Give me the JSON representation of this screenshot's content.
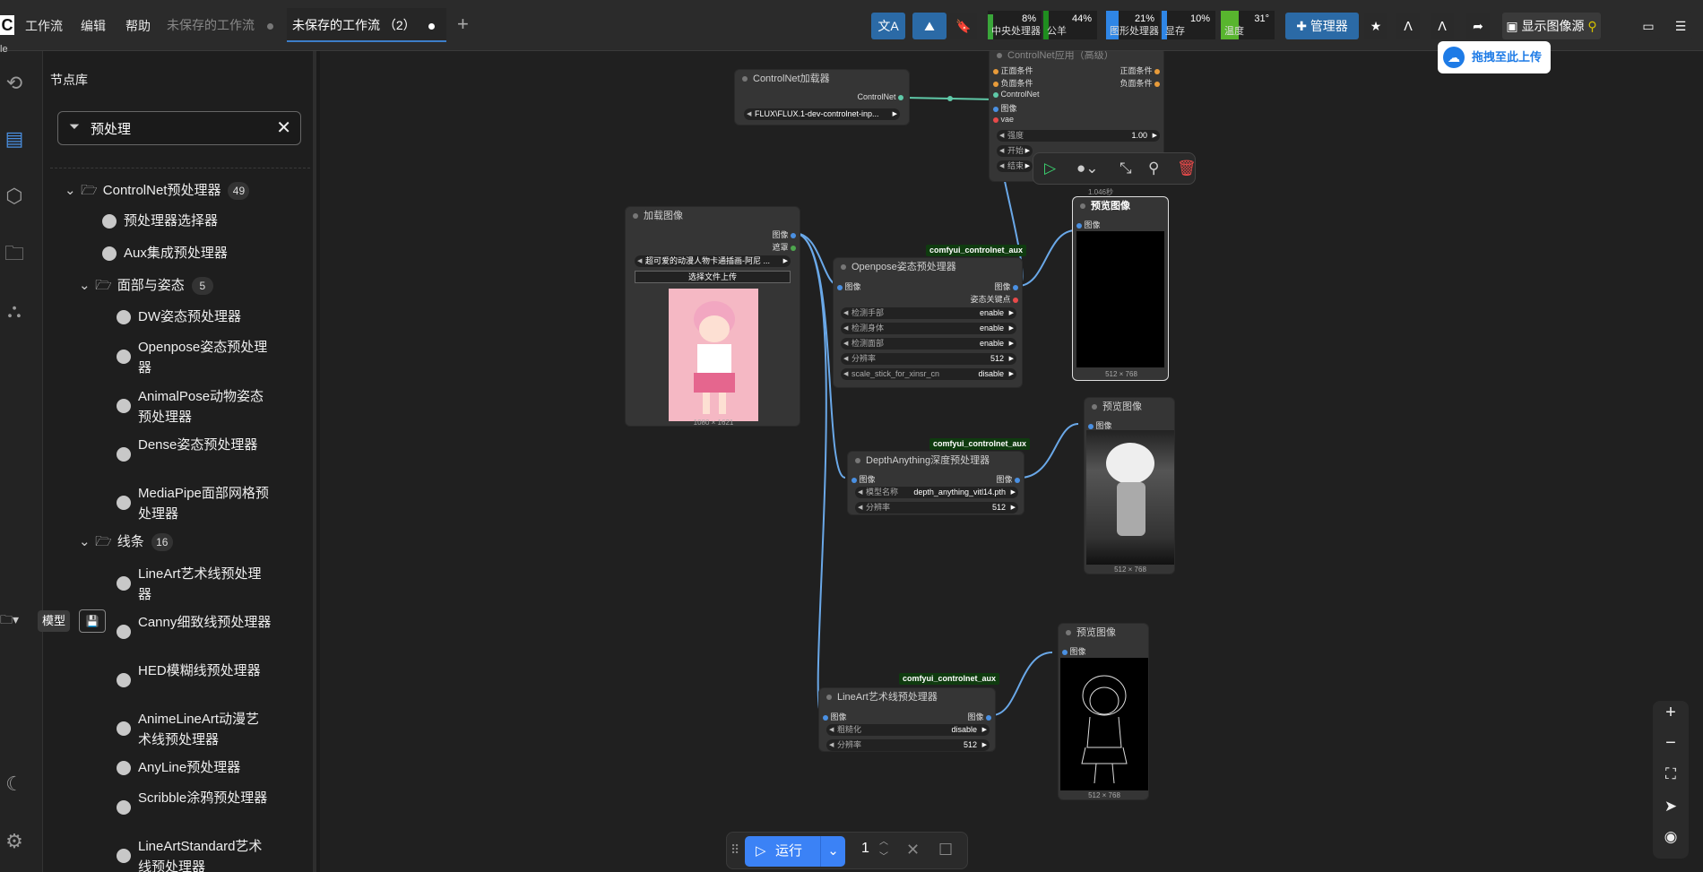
{
  "topbar": {
    "logo": "C",
    "menus": [
      "工作流",
      "编辑",
      "帮助"
    ],
    "tabs": [
      {
        "label": "未保存的工作流",
        "active": false
      },
      {
        "label": "未保存的工作流 （2）",
        "active": true
      }
    ],
    "add_tab": "+",
    "stats": [
      {
        "pct": "8%",
        "label": "中央处理器",
        "color": "#3aa63a"
      },
      {
        "pct": "44%",
        "label": "公羊",
        "color": "#3aa63a"
      },
      {
        "pct": "21%",
        "label": "图形处理器",
        "color": "#2f86e6"
      },
      {
        "pct": "10%",
        "label": "显存",
        "color": "#2f86e6"
      },
      {
        "pct": "31°",
        "label": "温度",
        "color": "#58b52e"
      }
    ],
    "manager_label": "管理器",
    "image_source_label": "显示图像源"
  },
  "rail": {
    "label": "le"
  },
  "panel": {
    "title": "节点库",
    "search_value": "预处理",
    "group1": {
      "label": "ControlNet预处理器",
      "count": "49"
    },
    "top_items": [
      "预处理器选择器",
      "Aux集成预处理器"
    ],
    "group2": {
      "label": "面部与姿态",
      "count": "5"
    },
    "face_items": [
      "DW姿态预处理器",
      "Openpose姿态预处理器",
      "AnimalPose动物姿态预处理器",
      "Dense姿态预处理器",
      "MediaPipe面部网格预处理器"
    ],
    "group3": {
      "label": "线条",
      "count": "16"
    },
    "line_items": [
      "LineArt艺术线预处理器",
      "Canny细致线预处理器",
      "HED模糊线预处理器",
      "AnimeLineArt动漫艺术线预处理器",
      "AnyLine预处理器",
      "Scribble涂鸦预处理器",
      "LineArtStandard艺术线预处理器"
    ],
    "model_chip": "模型"
  },
  "upload_float": "拖拽至此上传",
  "nodes": {
    "controlnet_loader": {
      "title": "ControlNet加载器",
      "out": "ControlNet",
      "model": "FLUX\\FLUX.1-dev-controlnet-inp..."
    },
    "apply": {
      "title": "ControlNet应用（高级）",
      "in_pos": "正面条件",
      "in_neg": "负面条件",
      "in_cn": "ControlNet",
      "in_img": "图像",
      "in_vae": "vae",
      "out_pos": "正面条件",
      "out_neg": "负面条件",
      "strength_label": "强度",
      "strength": "1.00",
      "start_label": "开始",
      "end_label": "结束"
    },
    "load_image": {
      "title": "加载图像",
      "out_img": "图像",
      "out_mask": "遮罩",
      "file": "超可爱的动漫人物卡通插画-阿尼 ...",
      "upload": "选择文件上传",
      "dims": "1080 × 1621"
    },
    "openpose": {
      "pkg": "comfyui_controlnet_aux",
      "title": "Openpose姿态预处理器",
      "in_img": "图像",
      "out_img": "图像",
      "out_kp": "姿态关键点",
      "widgets": [
        [
          "检测手部",
          "enable"
        ],
        [
          "检测身体",
          "enable"
        ],
        [
          "检测面部",
          "enable"
        ],
        [
          "分辨率",
          "512"
        ],
        [
          "scale_stick_for_xinsr_cn",
          "disable"
        ]
      ]
    },
    "preview1": {
      "title": "预览图像",
      "in": "图像",
      "dims": "512 × 768",
      "time": "1.046秒"
    },
    "depth": {
      "pkg": "comfyui_controlnet_aux",
      "title": "DepthAnything深度预处理器",
      "in_img": "图像",
      "out_img": "图像",
      "widgets": [
        [
          "模型名称",
          "depth_anything_vitl14.pth"
        ],
        [
          "分辨率",
          "512"
        ]
      ]
    },
    "preview2": {
      "title": "预览图像",
      "in": "图像",
      "dims": "512 × 768"
    },
    "lineart": {
      "pkg": "comfyui_controlnet_aux",
      "title": "LineArt艺术线预处理器",
      "in_img": "图像",
      "out_img": "图像",
      "widgets": [
        [
          "粗糙化",
          "disable"
        ],
        [
          "分辨率",
          "512"
        ]
      ]
    },
    "preview3": {
      "title": "预览图像",
      "in": "图像",
      "dims": "512 × 768"
    }
  },
  "runbar": {
    "run_label": "运行",
    "count": "1"
  }
}
